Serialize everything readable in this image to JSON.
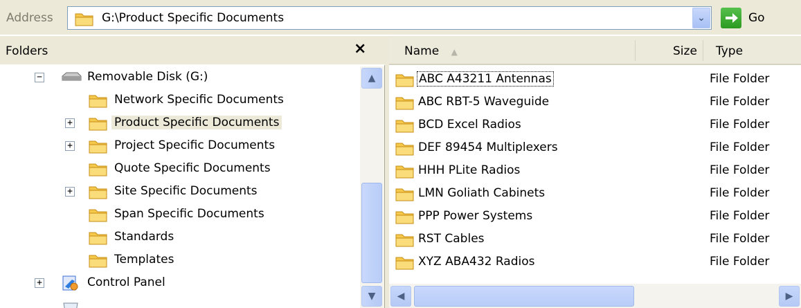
{
  "address_bar": {
    "label": "Address",
    "path": "G:\\Product Specific Documents",
    "go_label": "Go"
  },
  "folders_pane": {
    "title": "Folders",
    "close_glyph": "✕",
    "tree": [
      {
        "label": "Removable Disk (G:)",
        "icon": "drive-icon",
        "expander": "−"
      },
      {
        "label": "Network Specific Documents",
        "icon": "folder-icon",
        "expander": ""
      },
      {
        "label": "Product Specific Documents",
        "icon": "folder-icon",
        "expander": "+",
        "selected": true
      },
      {
        "label": "Project Specific Documents",
        "icon": "folder-icon",
        "expander": "+"
      },
      {
        "label": "Quote Specific Documents",
        "icon": "folder-icon",
        "expander": ""
      },
      {
        "label": "Site Specific Documents",
        "icon": "folder-icon",
        "expander": "+"
      },
      {
        "label": "Span Specific Documents",
        "icon": "folder-icon",
        "expander": ""
      },
      {
        "label": "Standards",
        "icon": "folder-icon",
        "expander": ""
      },
      {
        "label": "Templates",
        "icon": "folder-icon",
        "expander": ""
      },
      {
        "label": "Control Panel",
        "icon": "control-panel-icon",
        "expander": "+"
      }
    ]
  },
  "file_list": {
    "columns": {
      "name": "Name",
      "size": "Size",
      "type": "Type"
    },
    "rows": [
      {
        "name": "ABC A43211 Antennas",
        "type": "File Folder"
      },
      {
        "name": "ABC RBT-5 Waveguide",
        "type": "File Folder"
      },
      {
        "name": "BCD Excel Radios",
        "type": "File Folder"
      },
      {
        "name": "DEF 89454 Multiplexers",
        "type": "File Folder"
      },
      {
        "name": "HHH PLite Radios",
        "type": "File Folder"
      },
      {
        "name": "LMN Goliath Cabinets",
        "type": "File Folder"
      },
      {
        "name": "PPP Power Systems",
        "type": "File Folder"
      },
      {
        "name": "RST Cables",
        "type": "File Folder"
      },
      {
        "name": "XYZ ABA432 Radios",
        "type": "File Folder"
      }
    ]
  }
}
